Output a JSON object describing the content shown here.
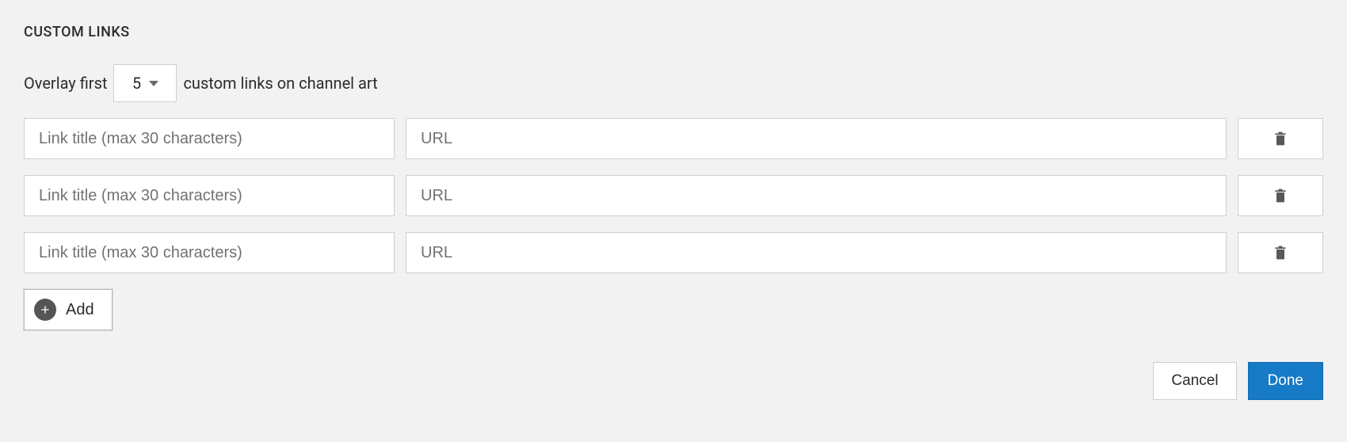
{
  "section_title": "CUSTOM LINKS",
  "overlay": {
    "prefix": "Overlay first",
    "value": "5",
    "suffix": "custom links on channel art"
  },
  "link_rows": [
    {
      "title_placeholder": "Link title (max 30 characters)",
      "url_placeholder": "URL"
    },
    {
      "title_placeholder": "Link title (max 30 characters)",
      "url_placeholder": "URL"
    },
    {
      "title_placeholder": "Link title (max 30 characters)",
      "url_placeholder": "URL"
    }
  ],
  "add_label": "Add",
  "cancel_label": "Cancel",
  "done_label": "Done"
}
